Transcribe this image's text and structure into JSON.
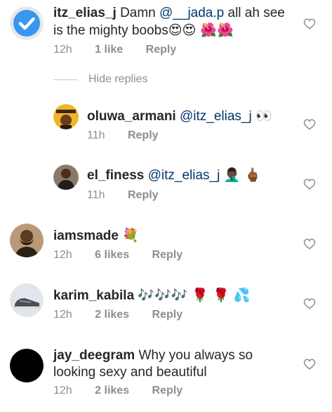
{
  "comments": [
    {
      "username": "itz_elias_j",
      "text_pre": "Damn ",
      "mention": "@__jada.p",
      "text_post": " all ah see is the mighty boobs",
      "emoji": "😍😍 🌺🌺",
      "time": "12h",
      "likes": "1 like",
      "reply": "Reply",
      "avatar_icon": "verified-badge"
    },
    {
      "username": "oluwa_armani",
      "mention": "@itz_elias_j",
      "emoji": "👀",
      "time": "11h",
      "reply": "Reply",
      "avatar_icon": "starboy-avatar"
    },
    {
      "username": "el_finess",
      "mention": "@itz_elias_j",
      "emoji": "🤦🏿‍♂️ 🖕🏾",
      "time": "11h",
      "reply": "Reply",
      "avatar_icon": "person-avatar"
    },
    {
      "username": "iamsmade",
      "emoji": "💐",
      "time": "12h",
      "likes": "6 likes",
      "reply": "Reply",
      "avatar_icon": "bearded-man-avatar"
    },
    {
      "username": "karim_kabila",
      "emoji": "🎶🎶🎶 🌹 🌹 💦",
      "time": "12h",
      "likes": "2 likes",
      "reply": "Reply",
      "avatar_icon": "sneaker-avatar"
    },
    {
      "username": "jay_deegram",
      "text": "Why you always so looking sexy and beautiful",
      "time": "12h",
      "likes": "2 likes",
      "reply": "Reply",
      "avatar_icon": "black-circle-avatar"
    }
  ],
  "hide_replies": "Hide replies",
  "colors": {
    "text": "#262626",
    "meta": "#8e8e8e",
    "mention": "#00376b",
    "verified": "#3897f0"
  }
}
